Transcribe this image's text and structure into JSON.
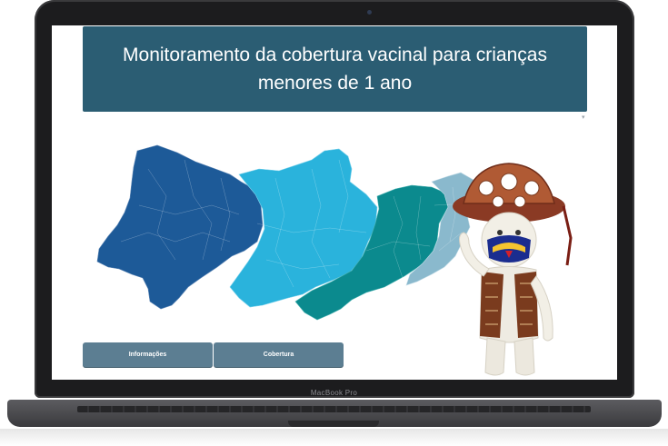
{
  "device": {
    "brand_label": "MacBook Pro"
  },
  "page": {
    "title": "Monitoramento da cobertura vacinal para crianças menores de 1 ano",
    "corner_mark": "▾"
  },
  "buttons": {
    "info_label": "Informações",
    "coverage_label": "Cobertura"
  },
  "map": {
    "region_colors": [
      "#1d5a98",
      "#2ab3dc",
      "#0b8a8e",
      "#8ab9cd"
    ]
  },
  "mascot": {
    "icon": "sertanejo-mascot-icon"
  }
}
